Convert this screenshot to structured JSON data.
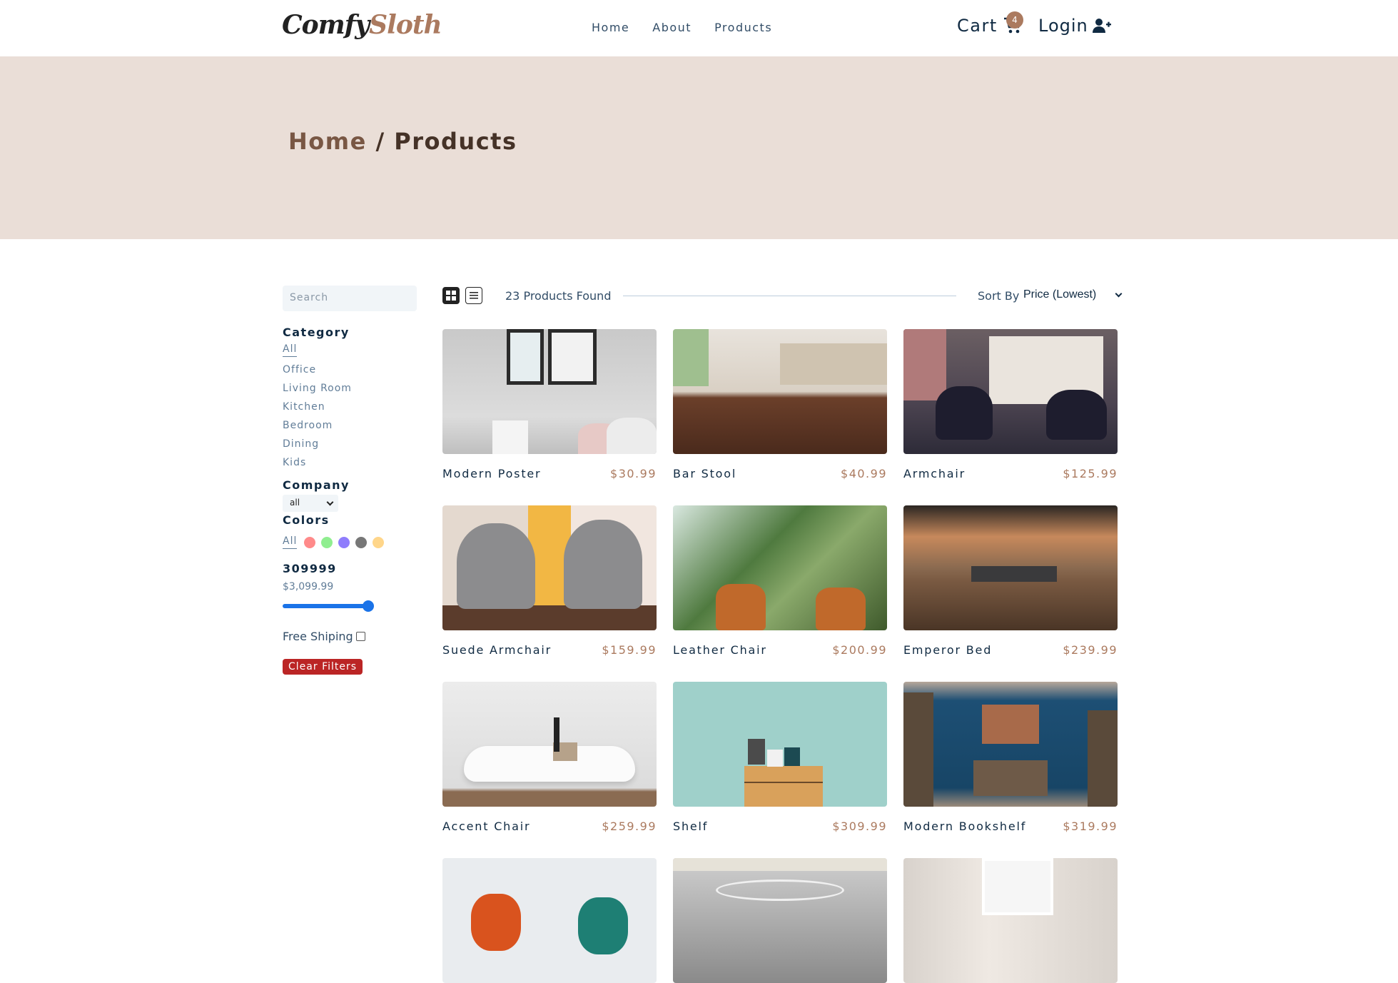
{
  "nav": {
    "logo_a": "Comfy",
    "logo_b": "Sloth",
    "links": [
      "Home",
      "About",
      "Products"
    ],
    "cart_label": "Cart",
    "cart_count": "4",
    "login_label": "Login"
  },
  "hero": {
    "crumb_home": "Home",
    "crumb_sep": " / ",
    "crumb_current": "Products"
  },
  "filters": {
    "search_placeholder": "Search",
    "category_title": "Category",
    "categories": [
      "All",
      "Office",
      "Living Room",
      "Kitchen",
      "Bedroom",
      "Dining",
      "Kids"
    ],
    "company_title": "Company",
    "company_value": "all",
    "colors_title": "Colors",
    "colors_all": "All",
    "colors": [
      "#ff8a8a",
      "#90ee90",
      "#8f7dfc",
      "#777777",
      "#ffd68a"
    ],
    "price_title": "309999",
    "price_value": "$3,099.99",
    "price_fraction": 1.0,
    "shipping_label": "Free Shiping",
    "clear_label": "Clear Filters"
  },
  "toolbar": {
    "count": "23 Products Found",
    "sort_label": "Sort By",
    "sort_value": "Price (Lowest)"
  },
  "products": [
    {
      "name": "Modern Poster",
      "price": "$30.99"
    },
    {
      "name": "Bar Stool",
      "price": "$40.99"
    },
    {
      "name": "Armchair",
      "price": "$125.99"
    },
    {
      "name": "Suede Armchair",
      "price": "$159.99"
    },
    {
      "name": "Leather Chair",
      "price": "$200.99"
    },
    {
      "name": "Emperor Bed",
      "price": "$239.99"
    },
    {
      "name": "Accent Chair",
      "price": "$259.99"
    },
    {
      "name": "Shelf",
      "price": "$309.99"
    },
    {
      "name": "Modern Bookshelf",
      "price": "$319.99"
    }
  ],
  "colors": {
    "accent": "#ab7a5f",
    "hero": "#eaded7",
    "danger": "#bb2525"
  }
}
